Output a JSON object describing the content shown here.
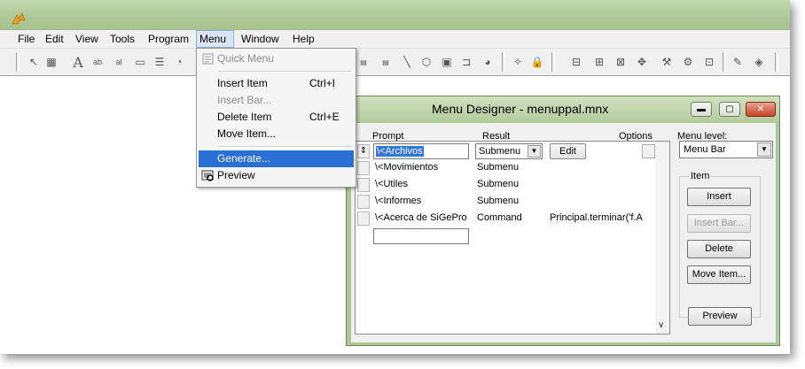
{
  "menubar": {
    "items": [
      {
        "label": "File"
      },
      {
        "label": "Edit"
      },
      {
        "label": "View"
      },
      {
        "label": "Tools"
      },
      {
        "label": "Program"
      },
      {
        "label": "Menu"
      },
      {
        "label": "Window"
      },
      {
        "label": "Help"
      }
    ]
  },
  "dropdown": {
    "quick_menu": "Quick Menu",
    "insert_item": "Insert Item",
    "insert_item_shortcut": "Ctrl+I",
    "insert_bar": "Insert Bar...",
    "delete_item": "Delete Item",
    "delete_item_shortcut": "Ctrl+E",
    "move_item": "Move Item...",
    "generate": "Generate...",
    "preview": "Preview"
  },
  "dialog": {
    "title": "Menu Designer - menuppal.mnx",
    "headers": {
      "prompt": "Prompt",
      "result": "Result",
      "options": "Options",
      "menu_level": "Menu level:"
    },
    "rows": [
      {
        "prompt": "\\<Archivos",
        "result": "Submenu",
        "edit": "Edit",
        "options": ""
      },
      {
        "prompt": "\\<Movimientos",
        "result": "Submenu",
        "options": ""
      },
      {
        "prompt": "\\<Utiles",
        "result": "Submenu",
        "options": ""
      },
      {
        "prompt": "\\<Informes",
        "result": "Submenu",
        "options": ""
      },
      {
        "prompt": "\\<Acerca de SiGePro",
        "result": "Command",
        "options": "Principal.terminar('f.A"
      }
    ],
    "menu_level_value": "Menu Bar",
    "item_group_label": "Item",
    "buttons": {
      "insert": "Insert",
      "insert_bar": "Insert Bar...",
      "delete": "Delete",
      "move_item": "Move Item...",
      "preview": "Preview"
    }
  },
  "colors": {
    "titlebar": "#adc795",
    "highlight": "#2a6fd4",
    "menu_active": "#dbe6f4"
  }
}
